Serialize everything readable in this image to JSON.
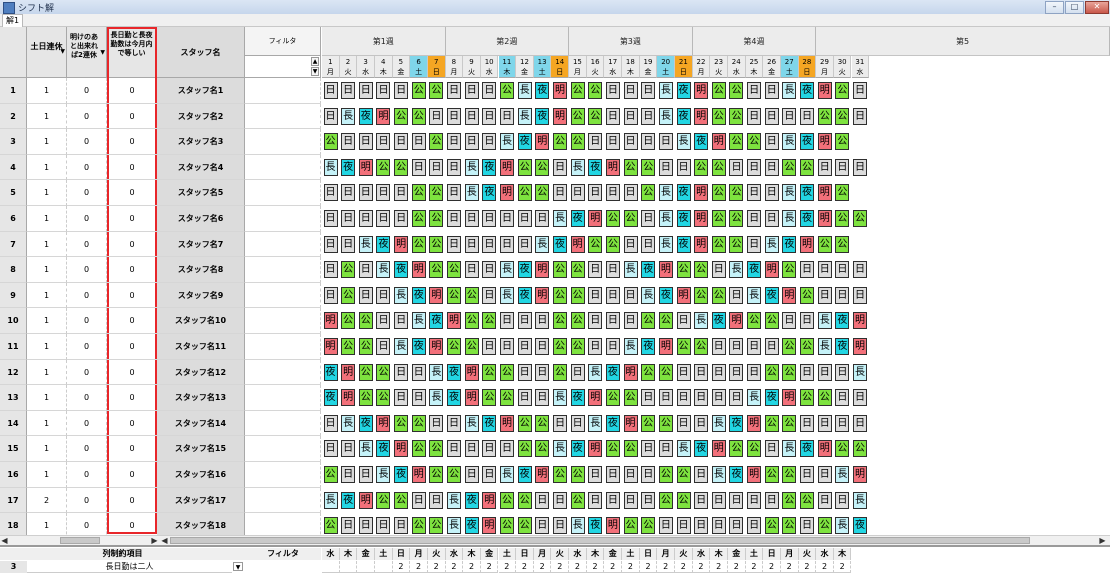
{
  "window": {
    "title": "シフト解"
  },
  "sheet_tab": "解1",
  "headers": {
    "col1": "土日連休",
    "col2": "明けのあと出来れば2連休",
    "col3": "長日勤と長夜勤数は今月内で等しい",
    "staff": "スタッフ名",
    "filter": "フィルタ"
  },
  "weeks": [
    "第1週",
    "第2週",
    "第3週",
    "第4週",
    "第5"
  ],
  "days": [
    {
      "d": "1",
      "w": "月"
    },
    {
      "d": "2",
      "w": "火"
    },
    {
      "d": "3",
      "w": "水"
    },
    {
      "d": "4",
      "w": "木"
    },
    {
      "d": "5",
      "w": "金"
    },
    {
      "d": "6",
      "w": "土"
    },
    {
      "d": "7",
      "w": "日"
    },
    {
      "d": "8",
      "w": "月"
    },
    {
      "d": "9",
      "w": "火"
    },
    {
      "d": "10",
      "w": "水"
    },
    {
      "d": "11",
      "w": "木"
    },
    {
      "d": "12",
      "w": "金"
    },
    {
      "d": "13",
      "w": "土"
    },
    {
      "d": "14",
      "w": "日"
    },
    {
      "d": "15",
      "w": "月"
    },
    {
      "d": "16",
      "w": "火"
    },
    {
      "d": "17",
      "w": "水"
    },
    {
      "d": "18",
      "w": "木"
    },
    {
      "d": "19",
      "w": "金"
    },
    {
      "d": "20",
      "w": "土"
    },
    {
      "d": "21",
      "w": "日"
    },
    {
      "d": "22",
      "w": "月"
    },
    {
      "d": "23",
      "w": "火"
    },
    {
      "d": "24",
      "w": "水"
    },
    {
      "d": "25",
      "w": "木"
    },
    {
      "d": "26",
      "w": "金"
    },
    {
      "d": "27",
      "w": "土"
    },
    {
      "d": "28",
      "w": "日"
    },
    {
      "d": "29",
      "w": "月"
    },
    {
      "d": "30",
      "w": "火"
    },
    {
      "d": "31",
      "w": "水"
    }
  ],
  "highlight_days": {
    "11": "sat",
    "13": "sat",
    "14": "sun",
    "20": "sat",
    "21": "sun",
    "6": "sat",
    "7": "sun",
    "27": "sat",
    "28": "sun"
  },
  "rows": [
    {
      "n": "1",
      "c1": "1",
      "c2": "0",
      "c3": "0",
      "name": "スタッフ名1",
      "s": "日日日日日公公日日日公長夜明公公日日日長夜明公公日日長夜明公日日"
    },
    {
      "n": "2",
      "c1": "1",
      "c2": "0",
      "c3": "0",
      "name": "スタッフ名2",
      "s": "日長夜明公公日日日日日長夜明公公日日日長夜明公公日日日日公公日長夜"
    },
    {
      "n": "3",
      "c1": "1",
      "c2": "0",
      "c3": "0",
      "name": "スタッフ名3",
      "s": "公日日日日日公日日日長夜明公公日日日日日長夜明公公日長夜明公"
    },
    {
      "n": "4",
      "c1": "1",
      "c2": "0",
      "c3": "0",
      "name": "スタッフ名4",
      "s": "長夜明公公日日日長夜明公公日長夜明公公日日公公日日日公公日日日"
    },
    {
      "n": "5",
      "c1": "1",
      "c2": "0",
      "c3": "0",
      "name": "スタッフ名5",
      "s": "日日日日日公公日長夜明公公日日日日日公長夜明公公日日長夜明公"
    },
    {
      "n": "6",
      "c1": "1",
      "c2": "0",
      "c3": "0",
      "name": "スタッフ名6",
      "s": "日日日日日公公日日日日日日長夜明公公日長夜明公公日日長夜明公公"
    },
    {
      "n": "7",
      "c1": "1",
      "c2": "0",
      "c3": "0",
      "name": "スタッフ名7",
      "s": "日日長夜明公公日日日日日長夜明公公日日長夜明公公日長夜明公公"
    },
    {
      "n": "8",
      "c1": "1",
      "c2": "0",
      "c3": "0",
      "name": "スタッフ名8",
      "s": "日公日長夜明公公日日長夜明公公日日長夜明公公日長夜明公日日日日"
    },
    {
      "n": "9",
      "c1": "1",
      "c2": "0",
      "c3": "0",
      "name": "スタッフ名9",
      "s": "日公日日長夜明公公日長夜明公公日日日長夜明公公日長夜明公日日日"
    },
    {
      "n": "10",
      "c1": "1",
      "c2": "0",
      "c3": "0",
      "name": "スタッフ名10",
      "s": "明公公日日長夜明公公日日日公公日日日公公日長夜明公公日日長夜明"
    },
    {
      "n": "11",
      "c1": "1",
      "c2": "0",
      "c3": "0",
      "name": "スタッフ名11",
      "s": "明公公日長夜明公公日日日日公公日日長夜明公公日日日日公公長夜明公"
    },
    {
      "n": "12",
      "c1": "1",
      "c2": "0",
      "c3": "0",
      "name": "スタッフ名12",
      "s": "夜明公公日日長夜明公公日日公日長夜明公公日日日日日公公日日日長"
    },
    {
      "n": "13",
      "c1": "1",
      "c2": "0",
      "c3": "0",
      "name": "スタッフ名13",
      "s": "夜明公公日日長夜明公公日日長夜明公公日日日日日日長夜明公公日日長"
    },
    {
      "n": "14",
      "c1": "1",
      "c2": "0",
      "c3": "0",
      "name": "スタッフ名14",
      "s": "日長夜明公公日日長夜明公公日日長夜明公公日日長夜明公公日日日日公"
    },
    {
      "n": "15",
      "c1": "1",
      "c2": "0",
      "c3": "0",
      "name": "スタッフ名15",
      "s": "日日長夜明公公日日日日公公長夜明公公日日長夜明公公日長夜明公公"
    },
    {
      "n": "16",
      "c1": "1",
      "c2": "0",
      "c3": "0",
      "name": "スタッフ名16",
      "s": "公日日長夜明公公日日長夜明公公日日日日公公日長夜明公公日日長明公"
    },
    {
      "n": "17",
      "c1": "2",
      "c2": "0",
      "c3": "0",
      "name": "スタッフ名17",
      "s": "長夜明公公日日長夜明公公日日公日日日日公公日日日日日公公日日長夜"
    },
    {
      "n": "18",
      "c1": "1",
      "c2": "0",
      "c3": "0",
      "name": "スタッフ名18",
      "s": "公日日日日公公長夜明公公日日長夜明公公日日日日日日公公日公長夜明"
    }
  ],
  "bottom": {
    "header_label": "列制約項目",
    "filter": "フィルタ",
    "weekdays": [
      "水",
      "木",
      "金",
      "土",
      "日",
      "月",
      "火",
      "水",
      "木",
      "金",
      "土",
      "日",
      "月",
      "火",
      "水",
      "木",
      "金",
      "土",
      "日",
      "月",
      "火",
      "水",
      "木",
      "金",
      "土",
      "日",
      "月",
      "火",
      "水",
      "木"
    ],
    "row3_num": "3",
    "row3_label": "長日勤は二人",
    "row3_values": [
      "",
      "",
      "",
      "",
      "2",
      "2",
      "2",
      "2",
      "2",
      "2",
      "2",
      "2",
      "2",
      "2",
      "2",
      "2",
      "2",
      "2",
      "2",
      "2",
      "2",
      "2",
      "2",
      "2",
      "2",
      "2",
      "2",
      "2",
      "2",
      "2"
    ]
  },
  "colors": {
    "hi": "#dcdcdc",
    "ko": "#7ee33f",
    "ch": "#c5f2f8",
    "ya": "#22d6e3",
    "ak": "#f2707a",
    "highlight": "#e8262a"
  }
}
